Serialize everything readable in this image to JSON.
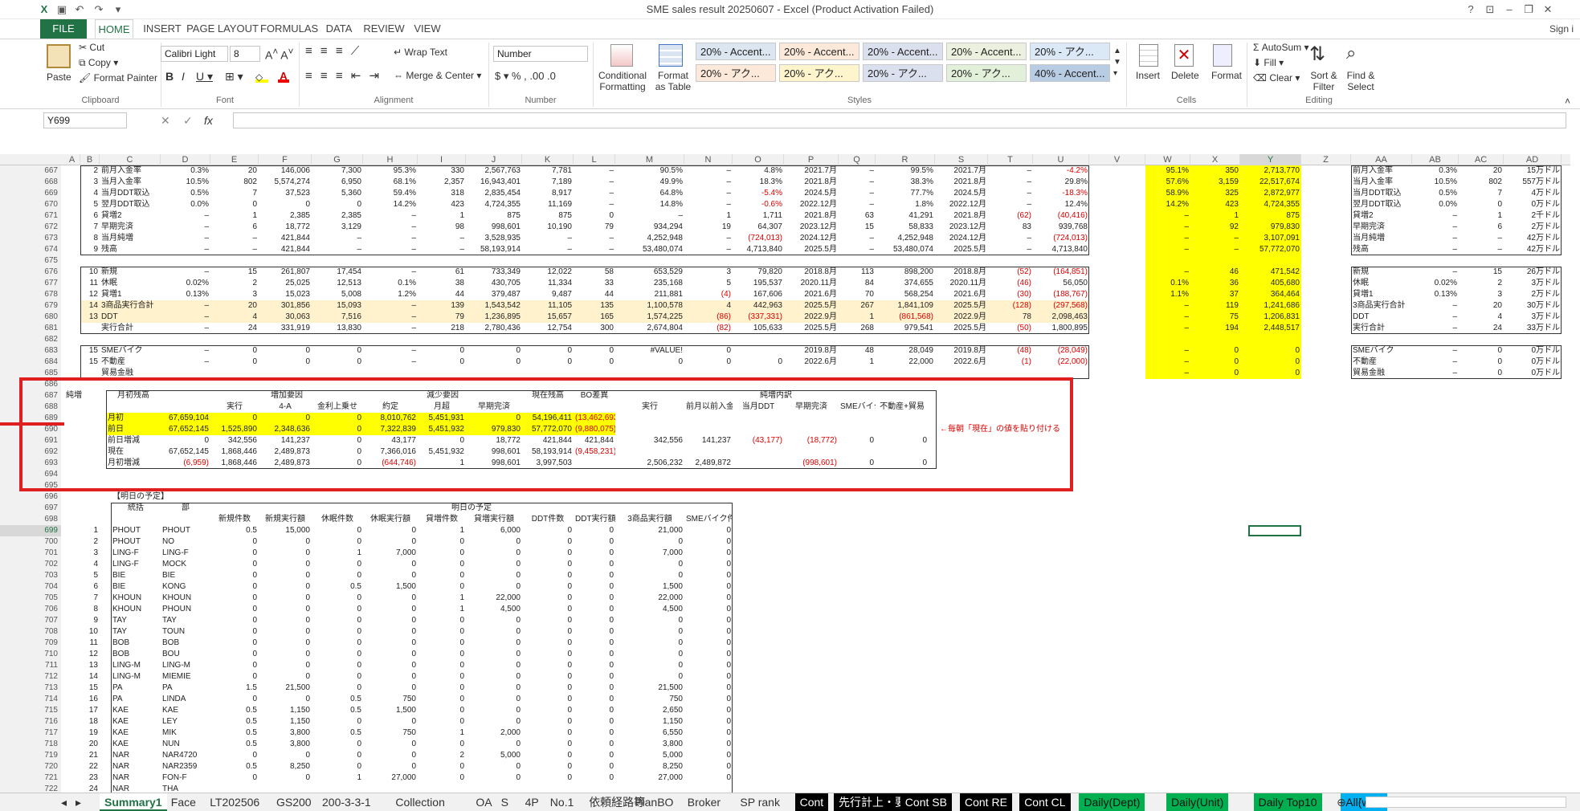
{
  "window": {
    "title": "SME sales result 20250607 - Excel (Product Activation Failed)",
    "signin": "Sign i"
  },
  "ribbon_tabs": [
    "FILE",
    "HOME",
    "INSERT",
    "PAGE LAYOUT",
    "FORMULAS",
    "DATA",
    "REVIEW",
    "VIEW"
  ],
  "clipboard": {
    "paste": "Paste",
    "cut": "Cut",
    "copy": "Copy",
    "format_painter": "Format Painter",
    "label": "Clipboard"
  },
  "font": {
    "name": "Calibri Light",
    "size": "8",
    "label": "Font"
  },
  "alignment": {
    "wrap": "Wrap Text",
    "merge": "Merge & Center",
    "label": "Alignment"
  },
  "number": {
    "format": "Number",
    "label": "Number"
  },
  "styles": {
    "cf": "Conditional Formatting",
    "fat": "Format as Table",
    "label": "Styles",
    "cells": [
      "20% - Accent...",
      "20% - Accent...",
      "20% - Accent...",
      "20% - Accent...",
      "20% - アク...",
      "20% - アク...",
      "20% - アク...",
      "20% - アク...",
      "20% - アク...",
      "40% - Accent..."
    ]
  },
  "cells_grp": {
    "insert": "Insert",
    "delete": "Delete",
    "format": "Format",
    "label": "Cells"
  },
  "editing": {
    "autosum": "AutoSum",
    "fill": "Fill",
    "clear": "Clear",
    "sort": "Sort & Filter",
    "find": "Find & Select",
    "label": "Editing"
  },
  "formula": {
    "namebox": "Y699",
    "fx": "fx",
    "value": ""
  },
  "columns": [
    "A",
    "B",
    "C",
    "D",
    "E",
    "F",
    "G",
    "H",
    "I",
    "J",
    "K",
    "L",
    "M",
    "N",
    "O",
    "P",
    "Q",
    "R",
    "S",
    "T",
    "U",
    "V",
    "W",
    "X",
    "Y",
    "Z",
    "AA",
    "AB",
    "AC",
    "AD"
  ],
  "top_rows": [
    [
      "667",
      "2",
      "前月入金率",
      "0.3%",
      "20",
      "146,006",
      "7,300",
      "95.3%",
      "330",
      "2,567,763",
      "7,781",
      "–",
      "90.5%",
      "–",
      "4.8%",
      "2021.7月",
      "–",
      "99.5%",
      "2021.7月",
      "–",
      "-4.2%"
    ],
    [
      "668",
      "3",
      "当月入金率",
      "10.5%",
      "802",
      "5,574,274",
      "6,950",
      "68.1%",
      "2,357",
      "16,943,401",
      "7,189",
      "–",
      "49.9%",
      "–",
      "18.3%",
      "2021.8月",
      "–",
      "38.3%",
      "2021.8月",
      "–",
      "29.8%"
    ],
    [
      "669",
      "4",
      "当月DDT取込",
      "0.5%",
      "7",
      "37,523",
      "5,360",
      "59.4%",
      "318",
      "2,835,454",
      "8,917",
      "–",
      "64.8%",
      "–",
      "-5.4%",
      "2024.5月",
      "–",
      "77.7%",
      "2024.5月",
      "–",
      "-18.3%"
    ],
    [
      "670",
      "5",
      "翌月DDT取込",
      "0.0%",
      "0",
      "0",
      "0",
      "14.2%",
      "423",
      "4,724,355",
      "11,169",
      "–",
      "14.8%",
      "–",
      "-0.6%",
      "2022.12月",
      "–",
      "1.8%",
      "2022.12月",
      "–",
      "12.4%"
    ],
    [
      "671",
      "6",
      "貸増2",
      "–",
      "1",
      "2,385",
      "2,385",
      "–",
      "1",
      "875",
      "875",
      "0",
      "–",
      "1",
      "1,711",
      "2021.8月",
      "63",
      "41,291",
      "2021.8月",
      "(62)",
      "(40,416)"
    ],
    [
      "672",
      "7",
      "早期完済",
      "–",
      "6",
      "18,772",
      "3,129",
      "–",
      "98",
      "998,601",
      "10,190",
      "79",
      "934,294",
      "19",
      "64,307",
      "2023.12月",
      "15",
      "58,833",
      "2023.12月",
      "83",
      "939,768"
    ],
    [
      "673",
      "8",
      "当月純増",
      "–",
      "–",
      "421,844",
      "–",
      "–",
      "–",
      "3,528,935",
      "–",
      "–",
      "4,252,948",
      "–",
      "(724,013)",
      "2024.12月",
      "–",
      "4,252,948",
      "2024.12月",
      "–",
      "(724,013)"
    ],
    [
      "674",
      "9",
      "残高",
      "–",
      "–",
      "421,844",
      "–",
      "–",
      "–",
      "58,193,914",
      "–",
      "–",
      "53,480,074",
      "–",
      "4,713,840",
      "2025.5月",
      "–",
      "53,480,074",
      "2025.5月",
      "–",
      "4,713,840"
    ]
  ],
  "mid_rows": [
    [
      "676",
      "10",
      "新規",
      "–",
      "15",
      "261,807",
      "17,454",
      "–",
      "61",
      "733,349",
      "12,022",
      "58",
      "653,529",
      "3",
      "79,820",
      "2018.8月",
      "113",
      "898,200",
      "2018.8月",
      "(52)",
      "(164,851)"
    ],
    [
      "677",
      "11",
      "休眠",
      "0.02%",
      "2",
      "25,025",
      "12,513",
      "0.1%",
      "38",
      "430,705",
      "11,334",
      "33",
      "235,168",
      "5",
      "195,537",
      "2020.11月",
      "84",
      "374,655",
      "2020.11月",
      "(46)",
      "56,050"
    ],
    [
      "678",
      "12",
      "貸増1",
      "0.13%",
      "3",
      "15,023",
      "5,008",
      "1.2%",
      "44",
      "379,487",
      "9,487",
      "44",
      "211,881",
      "(4)",
      "167,606",
      "2021.6月",
      "70",
      "568,254",
      "2021.6月",
      "(30)",
      "(188,767)"
    ],
    [
      "679",
      "14",
      "3商品実行合計",
      "–",
      "20",
      "301,856",
      "15,093",
      "–",
      "139",
      "1,543,542",
      "11,105",
      "135",
      "1,100,578",
      "4",
      "442,963",
      "2025.5月",
      "267",
      "1,841,109",
      "2025.5月",
      "(128)",
      "(297,568)"
    ],
    [
      "680",
      "13",
      "DDT",
      "–",
      "4",
      "30,063",
      "7,516",
      "–",
      "79",
      "1,236,895",
      "15,657",
      "165",
      "1,574,225",
      "(86)",
      "(337,331)",
      "2022.9月",
      "1",
      "(861,568)",
      "2022.9月",
      "78",
      "2,098,463"
    ],
    [
      "681",
      "",
      "実行合計",
      "–",
      "24",
      "331,919",
      "13,830",
      "–",
      "218",
      "2,780,436",
      "12,754",
      "300",
      "2,674,804",
      "(82)",
      "105,633",
      "2025.5月",
      "268",
      "979,541",
      "2025.5月",
      "(50)",
      "1,800,895"
    ]
  ],
  "low_rows": [
    [
      "683",
      "15",
      "SMEバイク",
      "–",
      "0",
      "0",
      "0",
      "–",
      "0",
      "0",
      "0",
      "0",
      "#VALUE!",
      "0",
      "",
      "2019.8月",
      "48",
      "28,049",
      "2019.8月",
      "(48)",
      "(28,049)"
    ],
    [
      "684",
      "15",
      "不動産",
      "–",
      "0",
      "0",
      "0",
      "–",
      "0",
      "0",
      "0",
      "0",
      "0",
      "0",
      "0",
      "2022.6月",
      "1",
      "22,000",
      "2022.6月",
      "(1)",
      "(22,000)"
    ],
    [
      "685",
      "",
      "貿易金融",
      "",
      "",
      "",
      "",
      "",
      "",
      "",
      "",
      "",
      "",
      "",
      "",
      "",
      "",
      "",
      "",
      "",
      ""
    ]
  ],
  "wy": [
    [
      "95.1%",
      "350",
      "2,713,770"
    ],
    [
      "57.6%",
      "3,159",
      "22,517,674"
    ],
    [
      "58.9%",
      "325",
      "2,872,977"
    ],
    [
      "14.2%",
      "423",
      "4,724,355"
    ],
    [
      "–",
      "1",
      "875"
    ],
    [
      "–",
      "92",
      "979,830"
    ],
    [
      "–",
      "–",
      "3,107,091"
    ],
    [
      "–",
      "–",
      "57,772,070"
    ],
    [
      "",
      "",
      ""
    ],
    [
      "–",
      "46",
      "471,542"
    ],
    [
      "0.1%",
      "36",
      "405,680"
    ],
    [
      "1.1%",
      "37",
      "364,464"
    ],
    [
      "–",
      "119",
      "1,241,686"
    ],
    [
      "–",
      "75",
      "1,206,831"
    ],
    [
      "–",
      "194",
      "2,448,517"
    ],
    [
      "",
      "",
      ""
    ],
    [
      "–",
      "0",
      "0"
    ],
    [
      "–",
      "0",
      "0"
    ],
    [
      "–",
      "0",
      "0"
    ]
  ],
  "aa": [
    [
      "前月入金率",
      "0.3%",
      "20",
      "15万ドル"
    ],
    [
      "当月入金率",
      "10.5%",
      "802",
      "557万ドル"
    ],
    [
      "当月DDT取込",
      "0.5%",
      "7",
      "4万ドル"
    ],
    [
      "翌月DDT取込",
      "0.0%",
      "0",
      "0万ドル"
    ],
    [
      "貸増2",
      "–",
      "1",
      "2千ドル"
    ],
    [
      "早期完済",
      "–",
      "6",
      "2万ドル"
    ],
    [
      "当月純増",
      "–",
      "–",
      "42万ドル"
    ],
    [
      "残高",
      "–",
      "–",
      "42万ドル"
    ],
    [
      "",
      "",
      "",
      ""
    ],
    [
      "新規",
      "–",
      "15",
      "26万ドル"
    ],
    [
      "休眠",
      "0.02%",
      "2",
      "3万ドル"
    ],
    [
      "貸増1",
      "0.13%",
      "3",
      "2万ドル"
    ],
    [
      "3商品実行合計",
      "–",
      "20",
      "30万ドル"
    ],
    [
      "DDT",
      "–",
      "4",
      "3万ドル"
    ],
    [
      "実行合計",
      "–",
      "24",
      "33万ドル"
    ],
    [
      "",
      "",
      "",
      ""
    ],
    [
      "SMEバイク",
      "–",
      "0",
      "0万ドル"
    ],
    [
      "不動産",
      "–",
      "0",
      "0万ドル"
    ],
    [
      "貿易金融",
      "–",
      "0",
      "0万ドル"
    ]
  ],
  "jun": {
    "title": "純増",
    "h_month": "月初残高",
    "h_inc": "増加要因",
    "h_dec": "減少要因",
    "h_now": "現在残高",
    "h_bo": "BO差異",
    "h_net": "純増内訳",
    "sub": [
      "実行",
      "4-A",
      "金利上乗せ",
      "約定",
      "月超",
      "早期完済",
      "実行",
      "前月以前入金",
      "当月DDT",
      "早期完済",
      "SMEバイク",
      "不動産+貿易"
    ],
    "rows": [
      [
        "月初",
        "67,659,104",
        "0",
        "0",
        "0",
        "8,010,762",
        "5,451,931",
        "0",
        "54,196,411",
        "(13,462,693)",
        "",
        "",
        "",
        "",
        "",
        ""
      ],
      [
        "前日",
        "67,652,145",
        "1,525,890",
        "2,348,636",
        "0",
        "7,322,839",
        "5,451,932",
        "979,830",
        "57,772,070",
        "(9,880,075)",
        "",
        "",
        "",
        "",
        "",
        ""
      ],
      [
        "前日増減",
        "0",
        "342,556",
        "141,237",
        "0",
        "43,177",
        "0",
        "18,772",
        "421,844",
        "421,844",
        "342,556",
        "141,237",
        "(43,177)",
        "(18,772)",
        "0",
        "0"
      ],
      [
        "現在",
        "67,652,145",
        "1,868,446",
        "2,489,873",
        "0",
        "7,366,016",
        "5,451,932",
        "998,601",
        "58,193,914",
        "(9,458,231)",
        "",
        "",
        "",
        "",
        "",
        ""
      ],
      [
        "月初増減",
        "(6,959)",
        "1,868,446",
        "2,489,873",
        "0",
        "(644,746)",
        "1",
        "998,601",
        "3,997,503",
        "",
        "2,506,232",
        "2,489,872",
        "",
        "(998,601)",
        "0",
        "0"
      ]
    ],
    "note": "←毎朝「現在」の値を貼り付ける"
  },
  "plan": {
    "section": "【明日の予定】",
    "h_group": "統括",
    "h_dept": "部",
    "h_title": "明日の予定",
    "cols": [
      "新規件数",
      "新規実行額",
      "休眠件数",
      "休眠実行額",
      "貸増件数",
      "貸増実行額",
      "DDT件数",
      "DDT実行額",
      "3商品実行額",
      "SMEバイク件数"
    ],
    "rows": [
      [
        "699",
        "1",
        "PHOUT",
        "PHOUT",
        "0.5",
        "15,000",
        "0",
        "0",
        "1",
        "6,000",
        "0",
        "0",
        "21,000",
        "0"
      ],
      [
        "700",
        "2",
        "PHOUT",
        "NO",
        "0",
        "0",
        "0",
        "0",
        "0",
        "0",
        "0",
        "0",
        "0",
        "0"
      ],
      [
        "701",
        "3",
        "LING-F",
        "LING-F",
        "0",
        "0",
        "1",
        "7,000",
        "0",
        "0",
        "0",
        "0",
        "7,000",
        "0"
      ],
      [
        "702",
        "4",
        "LING-F",
        "MOCK",
        "0",
        "0",
        "0",
        "0",
        "0",
        "0",
        "0",
        "0",
        "0",
        "0"
      ],
      [
        "703",
        "5",
        "BIE",
        "BIE",
        "0",
        "0",
        "0",
        "0",
        "0",
        "0",
        "0",
        "0",
        "0",
        "0"
      ],
      [
        "704",
        "6",
        "BIE",
        "KONG",
        "0",
        "0",
        "0.5",
        "1,500",
        "0",
        "0",
        "0",
        "0",
        "1,500",
        "0"
      ],
      [
        "705",
        "7",
        "KHOUN",
        "KHOUN",
        "0",
        "0",
        "0",
        "0",
        "1",
        "22,000",
        "0",
        "0",
        "22,000",
        "0"
      ],
      [
        "706",
        "8",
        "KHOUN",
        "PHOUN",
        "0",
        "0",
        "0",
        "0",
        "1",
        "4,500",
        "0",
        "0",
        "4,500",
        "0"
      ],
      [
        "707",
        "9",
        "TAY",
        "TAY",
        "0",
        "0",
        "0",
        "0",
        "0",
        "0",
        "0",
        "0",
        "0",
        "0"
      ],
      [
        "708",
        "10",
        "TAY",
        "TOUN",
        "0",
        "0",
        "0",
        "0",
        "0",
        "0",
        "0",
        "0",
        "0",
        "0"
      ],
      [
        "709",
        "11",
        "BOB",
        "BOB",
        "0",
        "0",
        "0",
        "0",
        "0",
        "0",
        "0",
        "0",
        "0",
        "0"
      ],
      [
        "710",
        "12",
        "BOB",
        "BOU",
        "0",
        "0",
        "0",
        "0",
        "0",
        "0",
        "0",
        "0",
        "0",
        "0"
      ],
      [
        "711",
        "13",
        "LING-M",
        "LING-M",
        "0",
        "0",
        "0",
        "0",
        "0",
        "0",
        "0",
        "0",
        "0",
        "0"
      ],
      [
        "712",
        "14",
        "LING-M",
        "MIEMIE",
        "0",
        "0",
        "0",
        "0",
        "0",
        "0",
        "0",
        "0",
        "0",
        "0"
      ],
      [
        "713",
        "15",
        "PA",
        "PA",
        "1.5",
        "21,500",
        "0",
        "0",
        "0",
        "0",
        "0",
        "0",
        "21,500",
        "0"
      ],
      [
        "714",
        "16",
        "PA",
        "LINDA",
        "0",
        "0",
        "0.5",
        "750",
        "0",
        "0",
        "0",
        "0",
        "750",
        "0"
      ],
      [
        "715",
        "17",
        "KAE",
        "KAE",
        "0.5",
        "1,150",
        "0.5",
        "1,500",
        "0",
        "0",
        "0",
        "0",
        "2,650",
        "0"
      ],
      [
        "716",
        "18",
        "KAE",
        "LEY",
        "0.5",
        "1,150",
        "0",
        "0",
        "0",
        "0",
        "0",
        "0",
        "1,150",
        "0"
      ],
      [
        "717",
        "19",
        "KAE",
        "MIK",
        "0.5",
        "3,800",
        "0.5",
        "750",
        "1",
        "2,000",
        "0",
        "0",
        "6,550",
        "0"
      ],
      [
        "718",
        "20",
        "KAE",
        "NUN",
        "0.5",
        "3,800",
        "0",
        "0",
        "0",
        "0",
        "0",
        "0",
        "3,800",
        "0"
      ],
      [
        "719",
        "21",
        "NAR",
        "NAR4720",
        "0",
        "0",
        "0",
        "0",
        "2",
        "5,000",
        "0",
        "0",
        "5,000",
        "0"
      ],
      [
        "720",
        "22",
        "NAR",
        "NAR2359",
        "0.5",
        "8,250",
        "0",
        "0",
        "0",
        "0",
        "0",
        "0",
        "8,250",
        "0"
      ],
      [
        "721",
        "23",
        "NAR",
        "FON-F",
        "0",
        "0",
        "1",
        "27,000",
        "0",
        "0",
        "0",
        "0",
        "27,000",
        "0"
      ],
      [
        "722",
        "24",
        "NAR",
        "THA",
        "",
        "",
        "",
        "",
        "",
        "",
        "",
        "",
        "",
        ""
      ]
    ]
  },
  "blank_rows": [
    "675",
    "682",
    "686",
    "694",
    "695"
  ],
  "sheet_tabs": [
    {
      "label": "Summary1",
      "style": "active"
    },
    {
      "label": "Face",
      "style": ""
    },
    {
      "label": "LT202506",
      "style": ""
    },
    {
      "label": "GS200",
      "style": ""
    },
    {
      "label": "200-3-3-1",
      "style": ""
    },
    {
      "label": "Collection",
      "style": ""
    },
    {
      "label": "OA",
      "style": ""
    },
    {
      "label": "S",
      "style": ""
    },
    {
      "label": "4P",
      "style": ""
    },
    {
      "label": "No.1",
      "style": ""
    },
    {
      "label": "依頼経路等",
      "style": ""
    },
    {
      "label": "PlanBO",
      "style": ""
    },
    {
      "label": "Broker",
      "style": ""
    },
    {
      "label": "SP rank",
      "style": ""
    },
    {
      "label": "Cont",
      "style": "dark"
    },
    {
      "label": "先行計上・要削除",
      "style": "dark"
    },
    {
      "label": "Cont SB",
      "style": "dark"
    },
    {
      "label": "Cont RE",
      "style": "dark"
    },
    {
      "label": "Cont CL",
      "style": "dark"
    },
    {
      "label": "Daily(Dept)",
      "style": "green"
    },
    {
      "label": "Daily(Unit)",
      "style": "green"
    },
    {
      "label": "Daily Top10",
      "style": "green"
    },
    {
      "label": "All(w ...",
      "style": "blue"
    }
  ],
  "colors": {
    "excel_green": "#217346",
    "highlight": "#ffff00",
    "alert_red": "#e02020"
  }
}
